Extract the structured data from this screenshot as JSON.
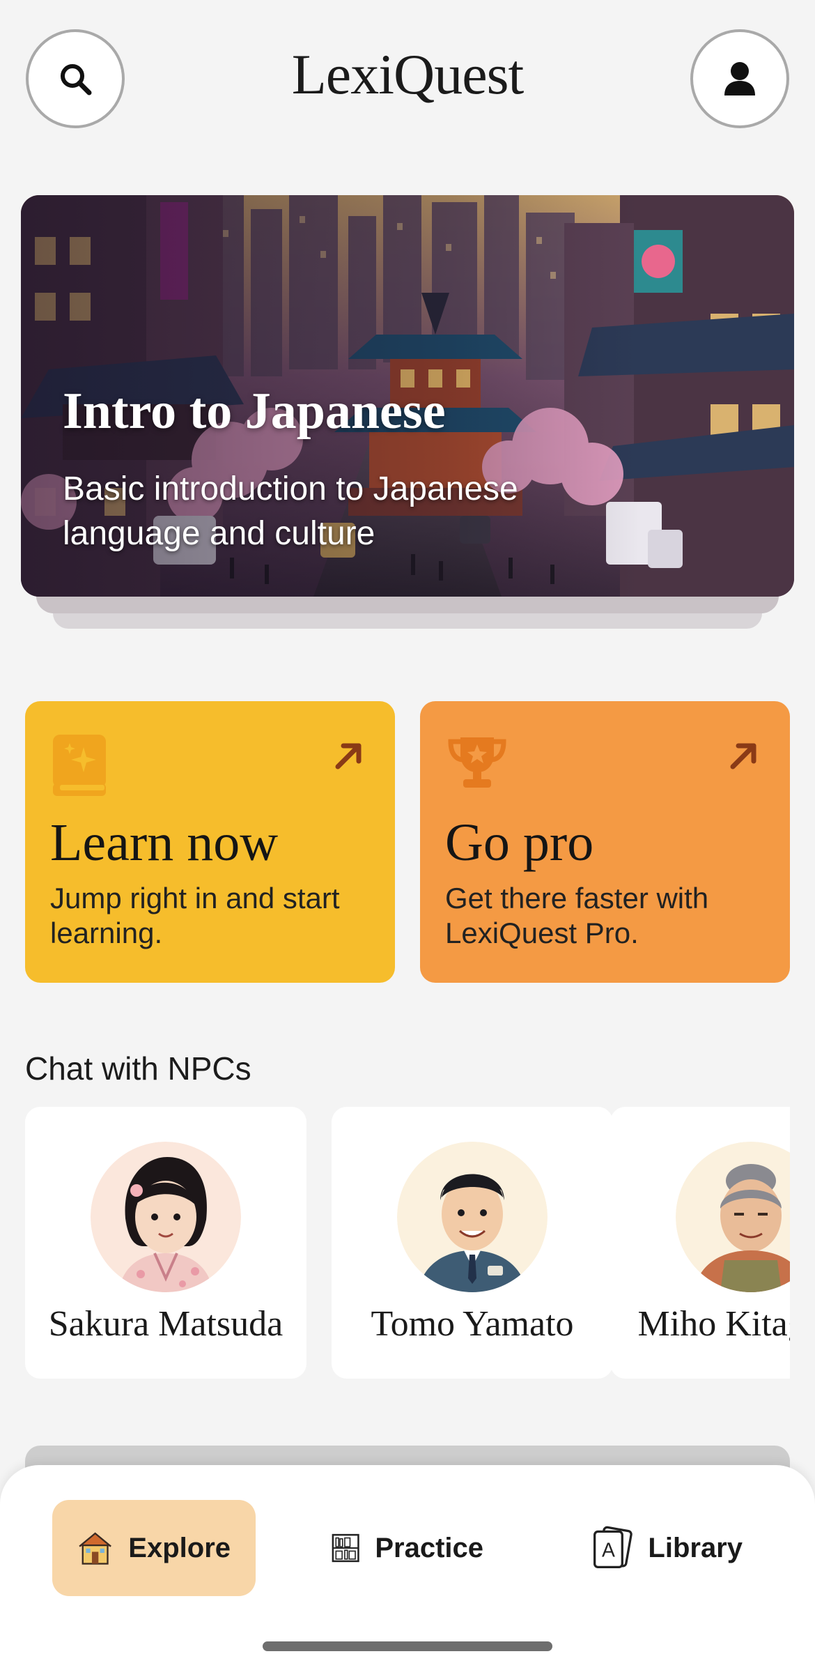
{
  "header": {
    "brand": "LexiQuest",
    "search_icon": "search-icon",
    "profile_icon": "user-icon"
  },
  "hero": {
    "title": "Intro to Japanese",
    "subtitle": "Basic introduction to Japanese language and culture",
    "image": "tokyo-street-illustration"
  },
  "actions": [
    {
      "title": "Learn now",
      "description": "Jump right in and start learning.",
      "icon": "sparkle-book-icon",
      "color": "#f6bd2c"
    },
    {
      "title": "Go pro",
      "description": "Get there faster with LexiQuest Pro.",
      "icon": "trophy-icon",
      "color": "#f49a44"
    }
  ],
  "npc_section": {
    "title": "Chat with NPCs",
    "npcs": [
      {
        "name": "Sakura Matsuda"
      },
      {
        "name": "Tomo Yamato"
      },
      {
        "name": "Miho Kitagawa"
      }
    ]
  },
  "tabbar": {
    "tabs": [
      {
        "label": "Explore",
        "icon": "house-icon",
        "active": true
      },
      {
        "label": "Practice",
        "icon": "bookshelf-icon",
        "active": false
      },
      {
        "label": "Library",
        "icon": "flashcards-icon",
        "active": false
      }
    ],
    "active_color": "#f8d6a8"
  }
}
